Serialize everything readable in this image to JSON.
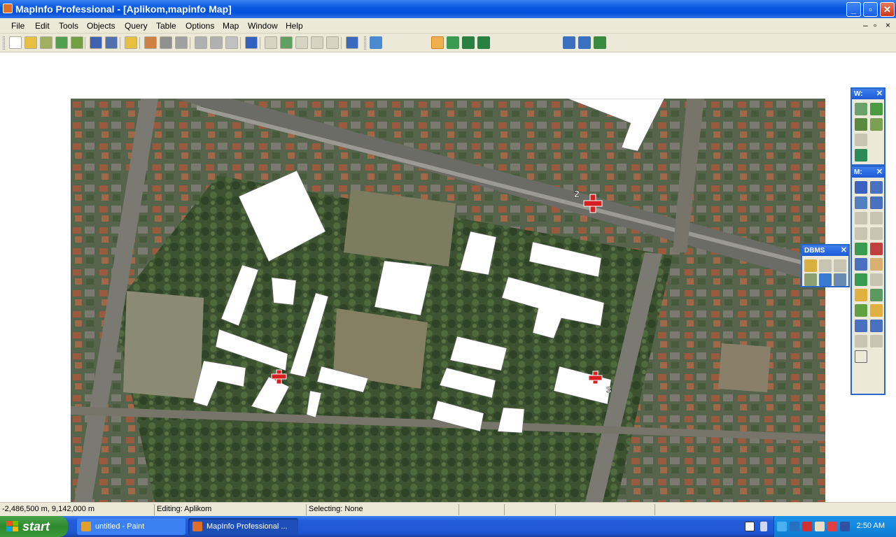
{
  "window": {
    "title": "MapInfo Professional - [Aplikom,mapinfo Map]",
    "minimize": "_",
    "maximize": "▫",
    "close": "✕"
  },
  "menubar": {
    "items": [
      "File",
      "Edit",
      "Tools",
      "Objects",
      "Query",
      "Table",
      "Options",
      "Map",
      "Window",
      "Help"
    ],
    "mdi_minimize": "–",
    "mdi_restore": "▫",
    "mdi_close": "×"
  },
  "toolbar": {
    "standard_icons": [
      "new-icon",
      "open-icon",
      "open-db-icon",
      "open-workspace-icon",
      "save-workspace-icon",
      "save-icon",
      "save-copy-icon",
      "open-folder-icon",
      "new-browser-icon",
      "print-icon",
      "print-preview-icon",
      "cut-icon",
      "copy-icon",
      "paste-icon",
      "undo-icon",
      "browser-icon",
      "map-icon",
      "graph-icon",
      "layout-icon",
      "redistrict-icon",
      "help-icon"
    ],
    "drawing_icons": [
      "symbol-icon",
      "line-icon",
      "polyline-icon",
      "arc-icon",
      "polygon-icon",
      "ellipse-icon",
      "rectangle-icon",
      "rounded-rect-icon",
      "text-icon",
      "frame-icon",
      "reshape-icon",
      "add-node-icon",
      "symbol-style-icon",
      "line-style-icon",
      "region-style-icon",
      "text-style-icon"
    ],
    "active_tool": "polygon-icon"
  },
  "map": {
    "labels": [
      "2",
      "3"
    ]
  },
  "palettes": {
    "tools_title": "W:",
    "main_title": "M:",
    "dbms_title": "DBMS",
    "close": "✕"
  },
  "statusbar": {
    "coords": "-2,486,500 m, 9,142,000 m",
    "editing": "Editing: Aplikom",
    "selecting": "Selecting: None"
  },
  "taskbar": {
    "start": "start",
    "tasks": [
      "untitled - Paint",
      "MapInfo Professional ..."
    ],
    "clock": "2:50 AM"
  },
  "colors": {
    "titlebar": "#0a5ae0",
    "accent_active": "#f0b050",
    "marker": "#d62020"
  }
}
